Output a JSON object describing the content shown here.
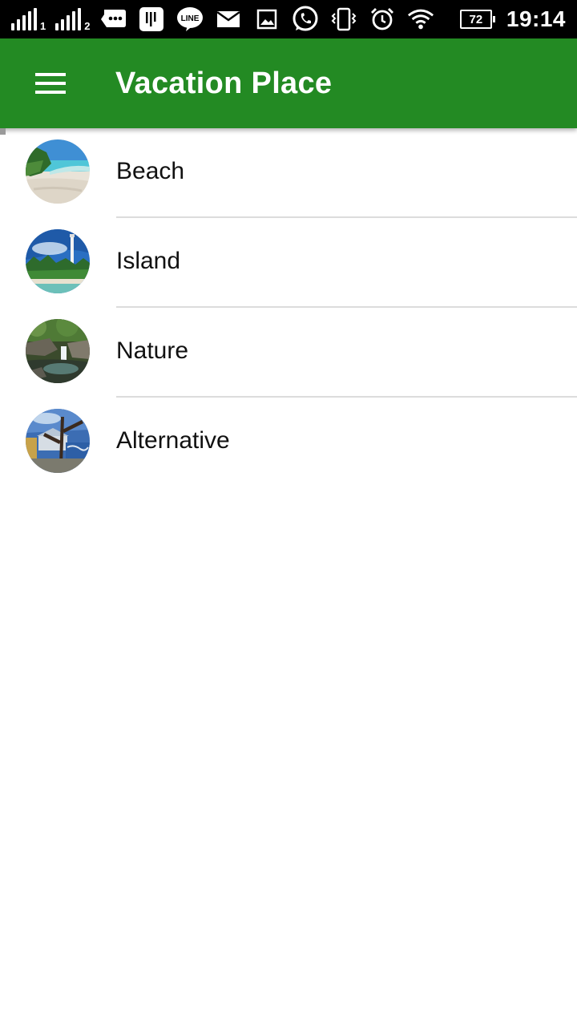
{
  "status_bar": {
    "sim1_label": "1",
    "sim2_label": "2",
    "battery_level": "72",
    "time": "19:14",
    "icons": [
      "signal-icon",
      "signal-icon",
      "chat-bubble-icon",
      "clipboard-icon",
      "line-icon",
      "mail-icon",
      "image-icon",
      "whatsapp-icon",
      "vibrate-icon",
      "alarm-icon",
      "wifi-icon",
      "battery-icon"
    ]
  },
  "app_bar": {
    "title": "Vacation Place",
    "color": "#238a23",
    "menu_icon": "menu-icon"
  },
  "places": [
    {
      "label": "Beach",
      "image": "beach-thumbnail"
    },
    {
      "label": "Island",
      "image": "island-thumbnail"
    },
    {
      "label": "Nature",
      "image": "nature-thumbnail"
    },
    {
      "label": "Alternative",
      "image": "alternative-thumbnail"
    }
  ]
}
